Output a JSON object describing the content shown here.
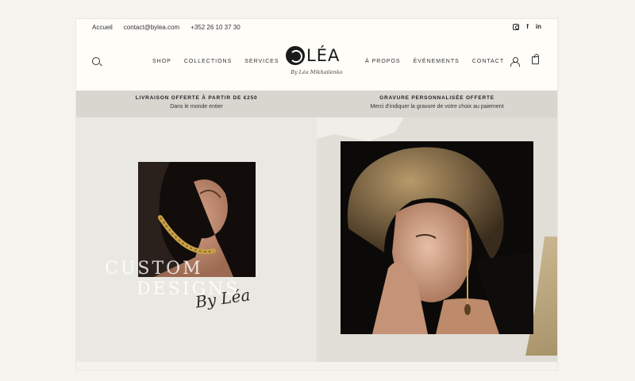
{
  "topbar": {
    "links": [
      "Accueil",
      "contact@bylea.com",
      "+352 26 10 37 30"
    ],
    "social": [
      "instagram-icon",
      "facebook-icon",
      "linkedin-icon"
    ]
  },
  "nav": {
    "left": [
      "SHOP",
      "COLLECTIONS",
      "SERVICES"
    ],
    "right": [
      "À PROPOS",
      "ÉVÉNEMENTS",
      "CONTACT"
    ]
  },
  "logo": {
    "word": "LÉA",
    "signature": "By Léa Mikhailenko"
  },
  "banner": {
    "left": {
      "title": "LIVRAISON OFFERTE À PARTIR DE €250",
      "subtitle": "Dans le monde entier"
    },
    "right": {
      "title": "GRAVURE PERSONNALISÉE OFFERTE",
      "subtitle": "Merci d'indiquer la gravure de votre choix au paiement"
    }
  },
  "hero": {
    "line1": "CUSTOM",
    "line2": "DESIGNS",
    "script": "By Léa"
  },
  "colors": {
    "background": "#f6f3ee",
    "banner": "#d9d6d0",
    "hero_left": "#eae8e2",
    "hero_right": "#e1ded7"
  }
}
